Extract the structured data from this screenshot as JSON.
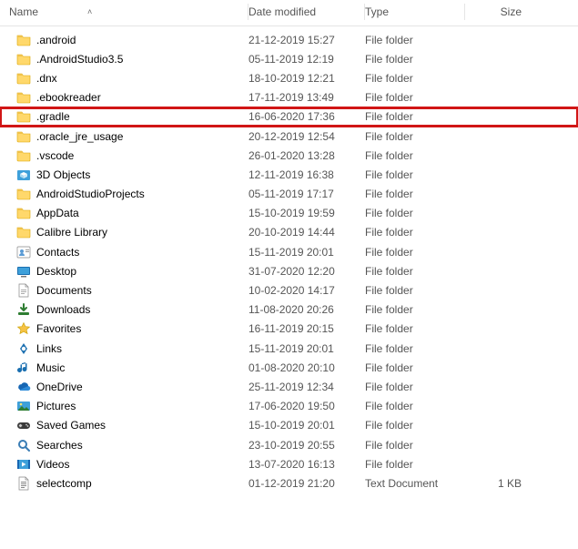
{
  "columns": {
    "name": "Name",
    "date": "Date modified",
    "type": "Type",
    "size": "Size"
  },
  "sort": {
    "column": "name",
    "dir": "asc"
  },
  "rows": [
    {
      "icon": "folder",
      "name": ".android",
      "date": "21-12-2019 15:27",
      "type": "File folder",
      "size": ""
    },
    {
      "icon": "folder",
      "name": ".AndroidStudio3.5",
      "date": "05-11-2019 12:19",
      "type": "File folder",
      "size": ""
    },
    {
      "icon": "folder",
      "name": ".dnx",
      "date": "18-10-2019 12:21",
      "type": "File folder",
      "size": ""
    },
    {
      "icon": "folder",
      "name": ".ebookreader",
      "date": "17-11-2019 13:49",
      "type": "File folder",
      "size": ""
    },
    {
      "icon": "folder",
      "name": ".gradle",
      "date": "16-06-2020 17:36",
      "type": "File folder",
      "size": "",
      "highlight": true
    },
    {
      "icon": "folder",
      "name": ".oracle_jre_usage",
      "date": "20-12-2019 12:54",
      "type": "File folder",
      "size": ""
    },
    {
      "icon": "folder",
      "name": ".vscode",
      "date": "26-01-2020 13:28",
      "type": "File folder",
      "size": ""
    },
    {
      "icon": "3dobjects",
      "name": "3D Objects",
      "date": "12-11-2019 16:38",
      "type": "File folder",
      "size": ""
    },
    {
      "icon": "folder",
      "name": "AndroidStudioProjects",
      "date": "05-11-2019 17:17",
      "type": "File folder",
      "size": ""
    },
    {
      "icon": "folder",
      "name": "AppData",
      "date": "15-10-2019 19:59",
      "type": "File folder",
      "size": ""
    },
    {
      "icon": "folder",
      "name": "Calibre Library",
      "date": "20-10-2019 14:44",
      "type": "File folder",
      "size": ""
    },
    {
      "icon": "contacts",
      "name": "Contacts",
      "date": "15-11-2019 20:01",
      "type": "File folder",
      "size": ""
    },
    {
      "icon": "desktop",
      "name": "Desktop",
      "date": "31-07-2020 12:20",
      "type": "File folder",
      "size": ""
    },
    {
      "icon": "documents",
      "name": "Documents",
      "date": "10-02-2020 14:17",
      "type": "File folder",
      "size": ""
    },
    {
      "icon": "downloads",
      "name": "Downloads",
      "date": "11-08-2020 20:26",
      "type": "File folder",
      "size": ""
    },
    {
      "icon": "favorites",
      "name": "Favorites",
      "date": "16-11-2019 20:15",
      "type": "File folder",
      "size": ""
    },
    {
      "icon": "links",
      "name": "Links",
      "date": "15-11-2019 20:01",
      "type": "File folder",
      "size": ""
    },
    {
      "icon": "music",
      "name": "Music",
      "date": "01-08-2020 20:10",
      "type": "File folder",
      "size": ""
    },
    {
      "icon": "onedrive",
      "name": "OneDrive",
      "date": "25-11-2019 12:34",
      "type": "File folder",
      "size": ""
    },
    {
      "icon": "pictures",
      "name": "Pictures",
      "date": "17-06-2020 19:50",
      "type": "File folder",
      "size": ""
    },
    {
      "icon": "savedgames",
      "name": "Saved Games",
      "date": "15-10-2019 20:01",
      "type": "File folder",
      "size": ""
    },
    {
      "icon": "searches",
      "name": "Searches",
      "date": "23-10-2019 20:55",
      "type": "File folder",
      "size": ""
    },
    {
      "icon": "videos",
      "name": "Videos",
      "date": "13-07-2020 16:13",
      "type": "File folder",
      "size": ""
    },
    {
      "icon": "textdoc",
      "name": "selectcomp",
      "date": "01-12-2019 21:20",
      "type": "Text Document",
      "size": "1 KB"
    }
  ]
}
